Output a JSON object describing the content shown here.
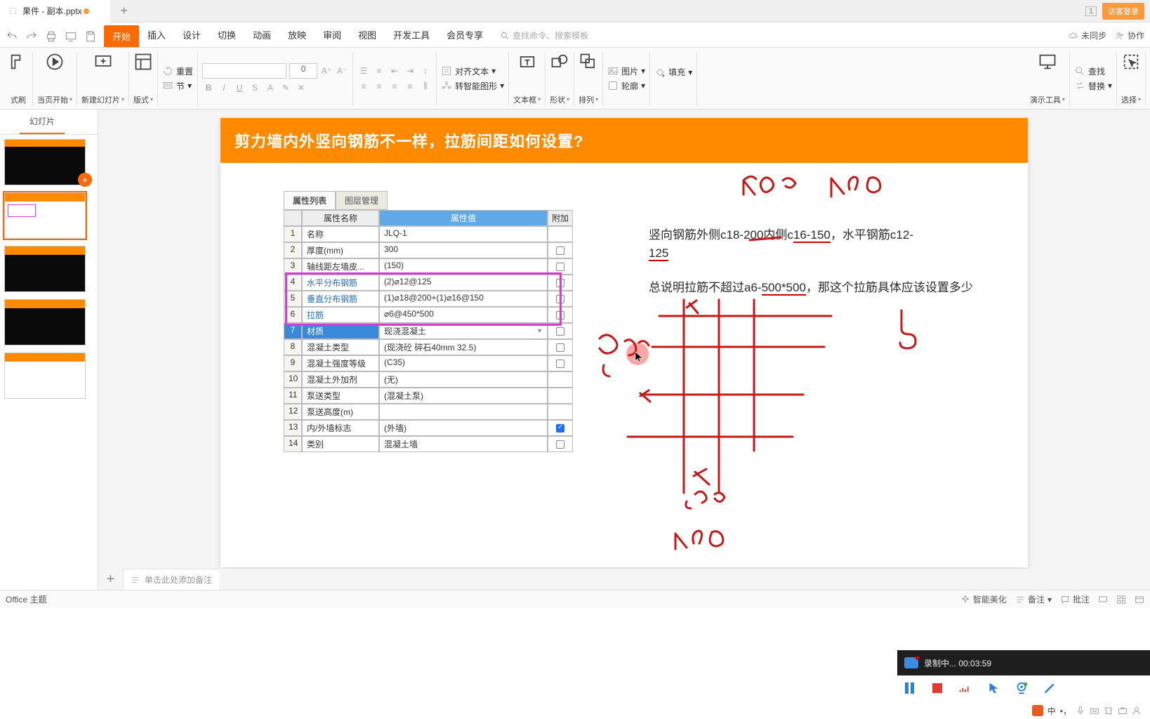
{
  "tabbar": {
    "filename": "果件 - 副本.pptx",
    "add": "+",
    "count": "1",
    "login": "访客登录"
  },
  "menubar": {
    "tabs": [
      "开始",
      "插入",
      "设计",
      "切换",
      "动画",
      "放映",
      "审阅",
      "视图",
      "开发工具",
      "会员专享"
    ],
    "search_placeholder": "查找命令、搜索模板",
    "sync": "未同步",
    "collab": "协作"
  },
  "ribbon": {
    "format_painter": "式刷",
    "from_current": "当页开始",
    "new_slide": "新建幻灯片",
    "layout": "版式",
    "reset": "重置",
    "section": "节",
    "font_size": "0",
    "align_text": "对齐文本",
    "smart_graphic": "转智能图形",
    "textbox": "文本框",
    "shape": "形状",
    "arrange": "排列",
    "image": "图片",
    "fill": "填充",
    "outline": "轮廓",
    "present_tools": "演示工具",
    "find": "查找",
    "replace": "替换",
    "select": "选择"
  },
  "thumbs": {
    "tab1": "",
    "tab2": "幻灯片"
  },
  "slide": {
    "title": "剪力墙内外竖向钢筋不一样，拉筋间距如何设置?",
    "prop_tabs": [
      "属性列表",
      "图层管理"
    ],
    "headers": {
      "name": "属性名称",
      "value": "属性值",
      "extra": "附加"
    },
    "rows": [
      {
        "n": "1",
        "name": "名称",
        "val": "JLQ-1",
        "chk": ""
      },
      {
        "n": "2",
        "name": "厚度(mm)",
        "val": "300",
        "chk": "off"
      },
      {
        "n": "3",
        "name": "轴线距左墙皮...",
        "val": "(150)",
        "chk": "off"
      },
      {
        "n": "4",
        "name": "水平分布钢筋",
        "val": "(2)⌀12@125",
        "chk": "off"
      },
      {
        "n": "5",
        "name": "垂直分布钢筋",
        "val": "(1)⌀18@200+(1)⌀16@150",
        "chk": "off"
      },
      {
        "n": "6",
        "name": "拉筋",
        "val": "⌀6@450*500",
        "chk": "off"
      },
      {
        "n": "7",
        "name": "材质",
        "val": "现浇混凝土",
        "chk": "off",
        "sel": true,
        "dd": true
      },
      {
        "n": "8",
        "name": "混凝土类型",
        "val": "(现浇砼 碎石40mm 32.5)",
        "chk": "off"
      },
      {
        "n": "9",
        "name": "混凝土强度等级",
        "val": "(C35)",
        "chk": "off"
      },
      {
        "n": "10",
        "name": "混凝土外加剂",
        "val": "(无)",
        "chk": ""
      },
      {
        "n": "11",
        "name": "泵送类型",
        "val": "(混凝土泵)",
        "chk": ""
      },
      {
        "n": "12",
        "name": "泵送高度(m)",
        "val": "",
        "chk": ""
      },
      {
        "n": "13",
        "name": "内/外墙标志",
        "val": "(外墙)",
        "chk": "on"
      },
      {
        "n": "14",
        "name": "类别",
        "val": "混凝土墙",
        "chk": "off"
      }
    ],
    "txt1_a": "竖向钢筋外侧c18-200内侧c",
    "txt1_b": "16-150",
    "txt1_c": "，水平钢筋c12-",
    "txt1_d": "125",
    "txt2_a": "总说明拉筋不超过a6-",
    "txt2_b": "500*500",
    "txt2_c": "，那这个拉筋具体应该设置多少"
  },
  "notes": {
    "placeholder": "单击此处添加备注"
  },
  "status": {
    "theme": "Office 主题",
    "beautify": "智能美化",
    "notes": "备注",
    "comments": "批注"
  },
  "recorder": {
    "label": "录制中... 00:03:59"
  },
  "ime": {
    "lang": "中"
  }
}
